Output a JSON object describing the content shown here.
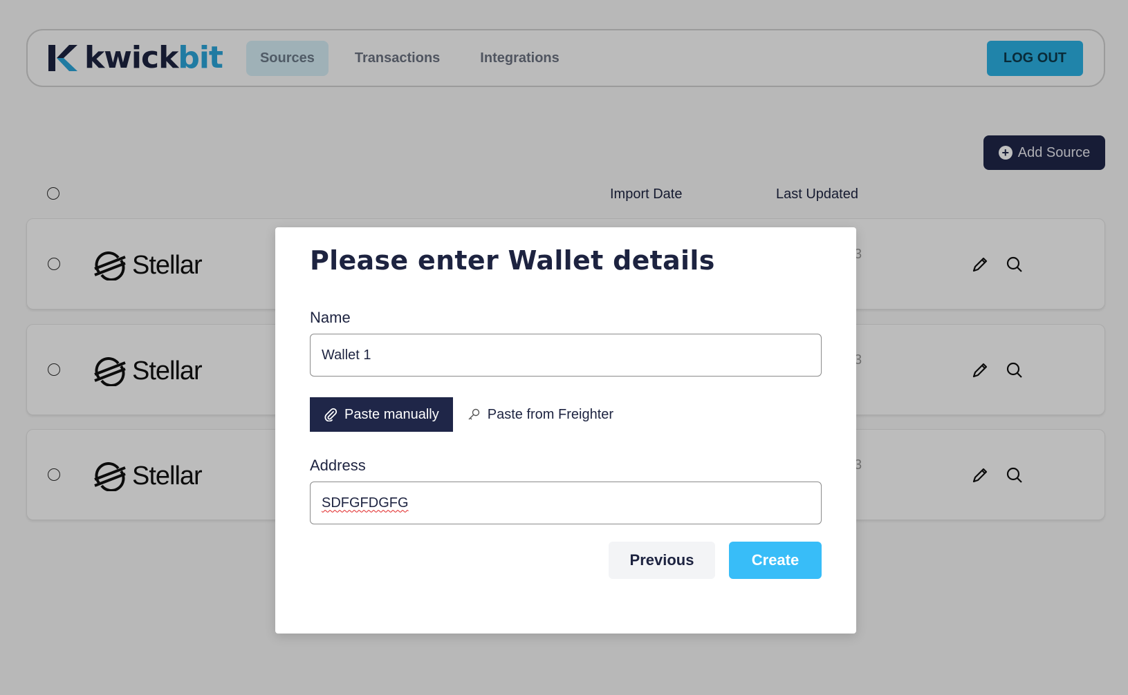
{
  "header": {
    "logo_part1": "kwick",
    "logo_part2": "bit",
    "nav": [
      {
        "label": "Sources"
      },
      {
        "label": "Transactions"
      },
      {
        "label": "Integrations"
      }
    ],
    "logout_label": "LOG OUT"
  },
  "toolbar": {
    "add_source_label": "Add Source"
  },
  "table": {
    "columns": {
      "import_date": "Import Date",
      "last_updated": "Last Updated"
    },
    "rows": [
      {
        "brand": "Stellar",
        "date_fragment": "3"
      },
      {
        "brand": "Stellar",
        "date_fragment": "3"
      },
      {
        "brand": "Stellar",
        "date_fragment": "3"
      }
    ]
  },
  "modal": {
    "title": "Please enter Wallet details",
    "name_label": "Name",
    "name_value": "Wallet 1",
    "paste_manually_label": "Paste manually",
    "paste_freighter_label": "Paste from Freighter",
    "address_label": "Address",
    "address_value": "SDFGFDGFG",
    "previous_label": "Previous",
    "create_label": "Create"
  },
  "colors": {
    "navy": "#1f2648",
    "brand_blue": "#2ba4d9",
    "create_blue": "#38bdf8"
  }
}
